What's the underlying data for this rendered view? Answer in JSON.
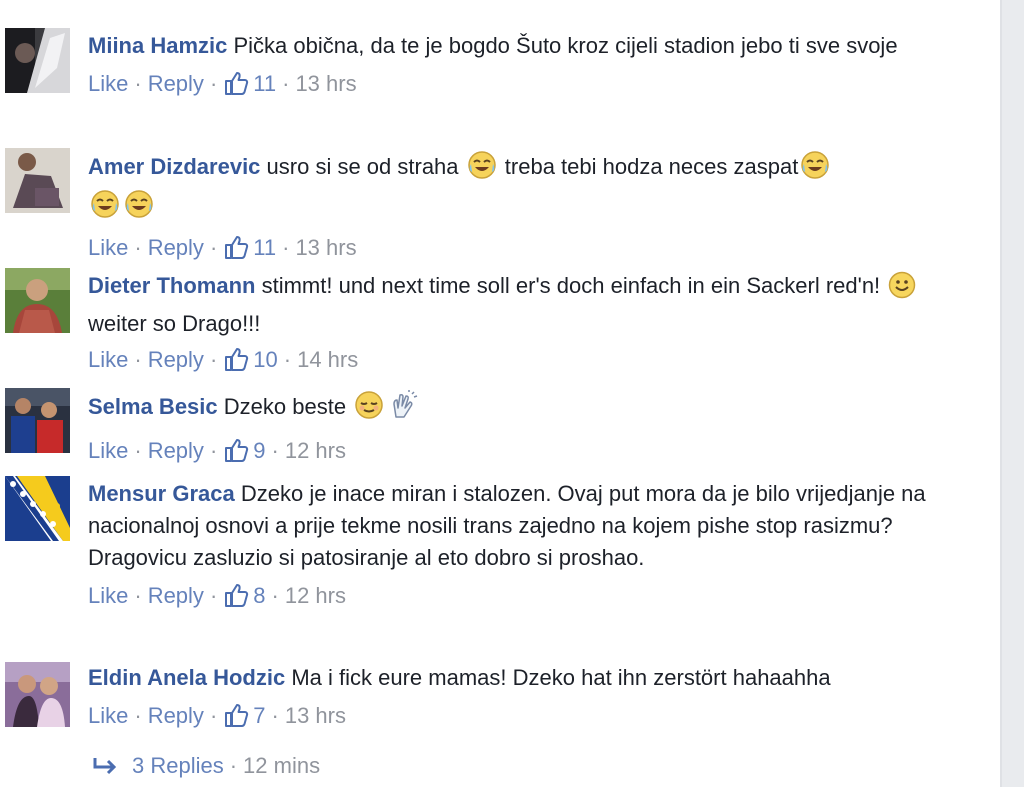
{
  "actions": {
    "like": "Like",
    "reply": "Reply",
    "separator": "·"
  },
  "comments": [
    {
      "author": "Miina Hamzic",
      "text": "Pička obična, da te je bogdo Šuto kroz cijeli stadion jebo ti sve svoje",
      "likes": "11",
      "time": "13 hrs",
      "avatar_icon": "profile-photo"
    },
    {
      "author": "Amer Dizdarevic",
      "text_a": "usro si se od straha",
      "text_b": "treba tebi hodza neces zaspat",
      "likes": "11",
      "time": "13 hrs",
      "emoji_icon": "tears-of-joy-emoji",
      "avatar_icon": "profile-photo"
    },
    {
      "author": "Dieter Thomann",
      "text_a": "stimmt! und next time soll er's doch einfach in ein Sackerl red'n!",
      "text_b": "weiter so Drago!!!",
      "likes": "10",
      "time": "14 hrs",
      "emoji_icon": "smile-emoji",
      "avatar_icon": "profile-photo"
    },
    {
      "author": "Selma Besic",
      "text": "Dzeko beste",
      "likes": "9",
      "time": "12 hrs",
      "emoji_icons": [
        "relieved-emoji",
        "clapping-hands-emoji"
      ],
      "avatar_icon": "profile-photo"
    },
    {
      "author": "Mensur Graca",
      "text": "Dzeko je inace miran i stalozen. Ovaj put mora da je bilo vrijedjanje na nacionalnoj osnovi a prije tekme nosili trans zajedno na kojem pishe stop rasizmu? Dragovicu zasluzio si patosiranje al eto dobro si proshao.",
      "likes": "8",
      "time": "12 hrs",
      "avatar_icon": "bosnian-flag-lilies"
    },
    {
      "author": "Eldin Anela Hodzic",
      "text": "Ma i fick eure mamas! Dzeko hat ihn zerstört hahaahha",
      "likes": "7",
      "time": "13 hrs",
      "avatar_icon": "profile-photo"
    }
  ],
  "replies_summary": {
    "label": "3 Replies",
    "time": "12 mins",
    "icon": "reply-arrow-icon"
  },
  "colors": {
    "author": "#365899",
    "meta": "#90949c",
    "link": "#4b6db0",
    "rail": "#e9ebee"
  }
}
